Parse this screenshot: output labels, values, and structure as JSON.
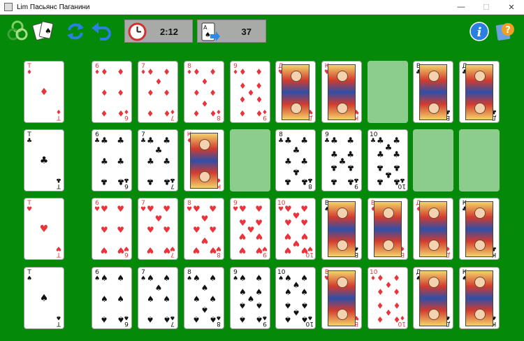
{
  "window": {
    "title": "Lim Пасьянс Паганини"
  },
  "toolbar": {
    "icons": [
      "game-menu-icon",
      "cards-icon",
      "new-deal-icon",
      "undo-icon",
      "info-icon",
      "help-icon"
    ],
    "timer": "2:12",
    "moves": "37"
  },
  "colors": {
    "felt": "#048a08",
    "slot": "#8ccc8c",
    "red_suit": "#e8343a"
  },
  "rows": [
    {
      "ace": {
        "rank": "Т",
        "suit": "♦",
        "color": "red"
      },
      "cards": [
        {
          "rank": "6",
          "suit": "♦",
          "color": "red"
        },
        {
          "rank": "7",
          "suit": "♦",
          "color": "red"
        },
        {
          "rank": "8",
          "suit": "♦",
          "color": "red"
        },
        {
          "rank": "9",
          "suit": "♦",
          "color": "red"
        },
        {
          "rank": "Д",
          "suit": "♥",
          "color": "red",
          "face": true
        },
        {
          "rank": "К",
          "suit": "♥",
          "color": "red",
          "face": true
        },
        null,
        {
          "rank": "В",
          "suit": "♣",
          "color": "blk",
          "face": true
        },
        {
          "rank": "Д",
          "suit": "♣",
          "color": "blk",
          "face": true
        }
      ]
    },
    {
      "ace": {
        "rank": "Т",
        "suit": "♣",
        "color": "blk"
      },
      "cards": [
        {
          "rank": "6",
          "suit": "♣",
          "color": "blk"
        },
        {
          "rank": "7",
          "suit": "♣",
          "color": "blk"
        },
        {
          "rank": "К",
          "suit": "♦",
          "color": "red",
          "face": true
        },
        null,
        {
          "rank": "8",
          "suit": "♣",
          "color": "blk"
        },
        {
          "rank": "9",
          "suit": "♣",
          "color": "blk"
        },
        {
          "rank": "10",
          "suit": "♣",
          "color": "blk"
        },
        null,
        null
      ]
    },
    {
      "ace": {
        "rank": "Т",
        "suit": "♥",
        "color": "red"
      },
      "cards": [
        {
          "rank": "6",
          "suit": "♥",
          "color": "red"
        },
        {
          "rank": "7",
          "suit": "♥",
          "color": "red"
        },
        {
          "rank": "8",
          "suit": "♥",
          "color": "red"
        },
        {
          "rank": "9",
          "suit": "♥",
          "color": "red"
        },
        {
          "rank": "10",
          "suit": "♥",
          "color": "red"
        },
        {
          "rank": "В",
          "suit": "♠",
          "color": "blk",
          "face": true
        },
        {
          "rank": "В",
          "suit": "♦",
          "color": "red",
          "face": true
        },
        {
          "rank": "Д",
          "suit": "♦",
          "color": "red",
          "face": true
        },
        {
          "rank": "К",
          "suit": "♣",
          "color": "blk",
          "face": true
        }
      ]
    },
    {
      "ace": {
        "rank": "Т",
        "suit": "♠",
        "color": "blk"
      },
      "cards": [
        {
          "rank": "6",
          "suit": "♠",
          "color": "blk"
        },
        {
          "rank": "7",
          "suit": "♠",
          "color": "blk"
        },
        {
          "rank": "8",
          "suit": "♠",
          "color": "blk"
        },
        {
          "rank": "9",
          "suit": "♠",
          "color": "blk"
        },
        {
          "rank": "10",
          "suit": "♠",
          "color": "blk"
        },
        {
          "rank": "В",
          "suit": "♥",
          "color": "red",
          "face": true
        },
        {
          "rank": "10",
          "suit": "♦",
          "color": "red"
        },
        {
          "rank": "Д",
          "suit": "♠",
          "color": "blk",
          "face": true
        },
        {
          "rank": "К",
          "suit": "♠",
          "color": "blk",
          "face": true
        }
      ]
    }
  ]
}
